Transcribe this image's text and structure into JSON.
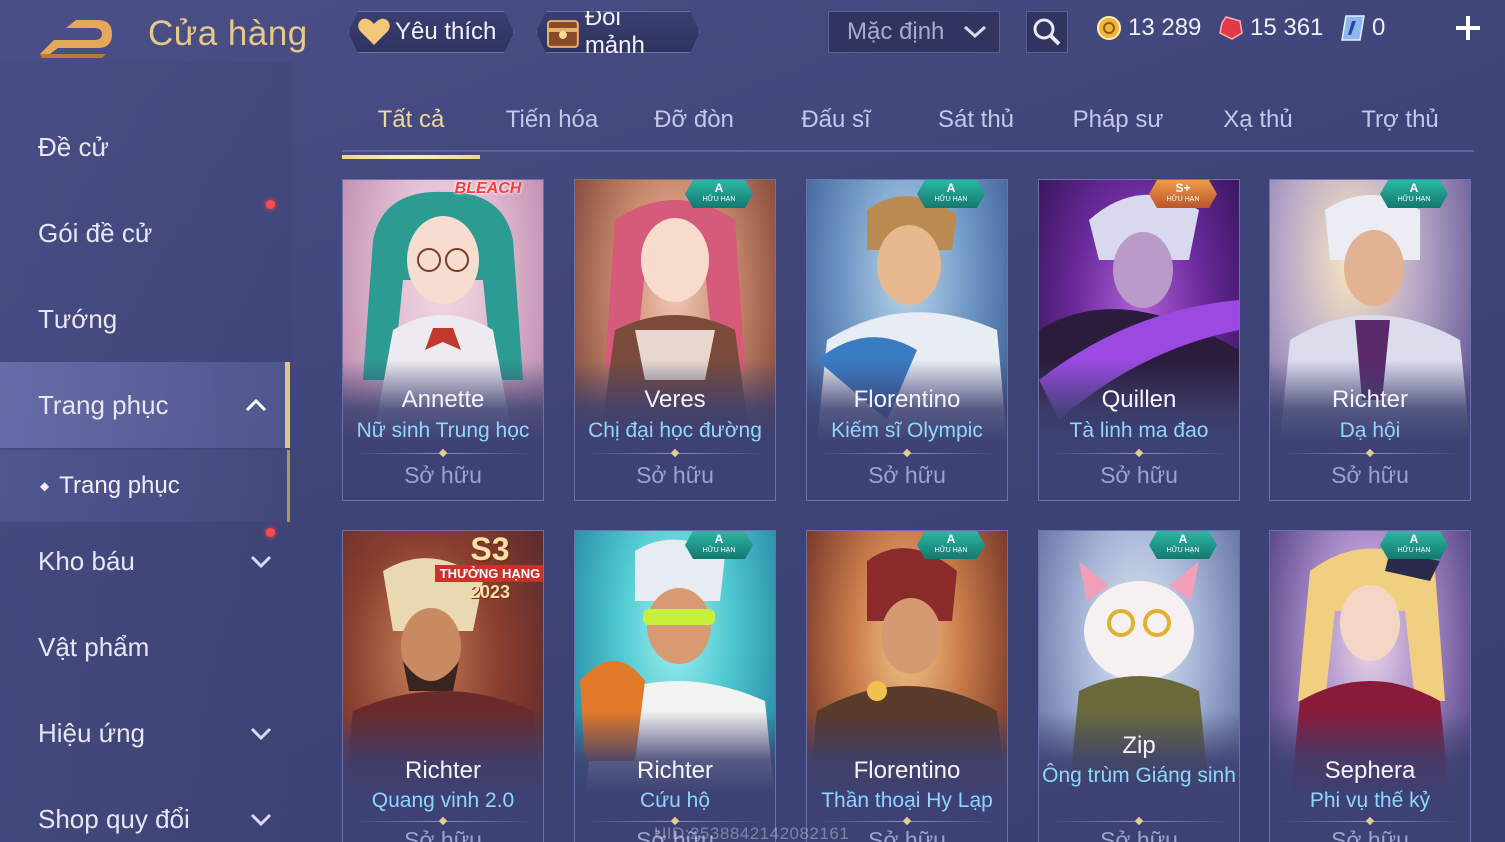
{
  "header": {
    "title": "Cửa hàng",
    "favorite_label": "Yêu thích",
    "exchange_label": "Đổi mảnh",
    "sort_value": "Mặc định",
    "currencies": {
      "gold": "13 289",
      "ruby": "15 361",
      "voucher": "0"
    }
  },
  "sidebar": {
    "items": [
      {
        "label": "Đề cử"
      },
      {
        "label": "Gói đề cử"
      },
      {
        "label": "Tướng"
      },
      {
        "label": "Trang phục"
      },
      {
        "label": "Kho báu"
      },
      {
        "label": "Vật phẩm"
      },
      {
        "label": "Hiệu ứng"
      },
      {
        "label": "Shop quy đổi"
      }
    ],
    "sub_item": "Trang phục"
  },
  "tabs": [
    "Tất cả",
    "Tiến hóa",
    "Đỡ đòn",
    "Đấu sĩ",
    "Sát thủ",
    "Pháp sư",
    "Xạ thủ",
    "Trợ thủ"
  ],
  "cards": [
    {
      "hero": "Annette",
      "skin": "Nữ sinh Trung học",
      "status": "Sở hữu",
      "badge_text": "BLEACH"
    },
    {
      "hero": "Veres",
      "skin": "Chị đại học đường",
      "status": "Sở hữu",
      "grade": "A",
      "limited": "HỮU HẠN"
    },
    {
      "hero": "Florentino",
      "skin": "Kiếm sĩ Olympic",
      "status": "Sở hữu",
      "grade": "A",
      "limited": "HỮU HẠN"
    },
    {
      "hero": "Quillen",
      "skin": "Tà linh ma đao",
      "status": "Sở hữu",
      "grade": "S+",
      "limited": "HỮU HẠN"
    },
    {
      "hero": "Richter",
      "skin": "Dạ hội",
      "status": "Sở hữu",
      "grade": "A",
      "limited": "HỮU HẠN"
    },
    {
      "hero": "Richter",
      "skin": "Quang vinh 2.0",
      "status": "Sở hữu",
      "s3_big": "S3",
      "s3_band": "THƯỞNG HẠNG",
      "s3_year": "2023"
    },
    {
      "hero": "Richter",
      "skin": "Cứu hộ",
      "status": "Sở hữu",
      "grade": "A",
      "limited": "HỮU HẠN"
    },
    {
      "hero": "Florentino",
      "skin": "Thần thoại Hy Lạp",
      "status": "Sở hữu",
      "grade": "A",
      "limited": "HỮU HẠN"
    },
    {
      "hero": "Zip",
      "skin": "Ông trùm Giáng sinh",
      "status": "Sở hữu",
      "grade": "A",
      "limited": "HỮU HẠN"
    },
    {
      "hero": "Sephera",
      "skin": "Phi vụ thế kỷ",
      "status": "Sở hữu",
      "grade": "A",
      "limited": "HỮU HẠN"
    }
  ],
  "watermark": "UID:2538842142082161",
  "colors": {
    "title_gold": "#e6c888",
    "skin_blue": "#8fd6ff",
    "active_tab": "#f1d79b",
    "badge_teal": "#2bb7a4",
    "notify_red": "#ff4a4a"
  }
}
